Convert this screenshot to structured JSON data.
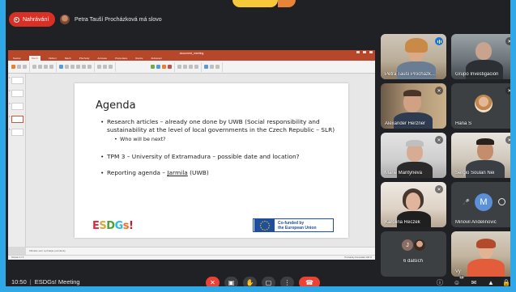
{
  "recording": {
    "label": "Nahrávání"
  },
  "speaking": {
    "text": "Petra Tauší Procházková má slovo"
  },
  "presentation": {
    "window_title": "document_meeting",
    "tabs": [
      "Soubor",
      "Domů",
      "Vložení",
      "Návrh",
      "Přechody",
      "Animace",
      "Prezentace",
      "Revize",
      "Zobrazení"
    ],
    "notes_placeholder": "Klikněte sem a přidejte poznámky",
    "status_left": "Snímek 4 z 5",
    "status_right": "Poznámky  Komentáře   100 %",
    "slide": {
      "title": "Agenda",
      "items": [
        "Research articles – already one done by UWB (Social responsibility and sustainability at the level of local governments in the Czech Republic – SLR)",
        "TPM 3 – University of Extramadura – possible date and location?",
        "Reporting agenda – "
      ],
      "sub_item": "Who will be next? ",
      "reporting_name": "Jarmila",
      "reporting_tail": " (UWB)",
      "logo_text": [
        "E",
        "S",
        "D",
        "G",
        "s",
        "!"
      ],
      "eu_text_line1": "Co-funded by",
      "eu_text_line2": "the European Union"
    }
  },
  "participants": [
    {
      "name": "Petra Tauší Procházk...",
      "state": "speaking"
    },
    {
      "name": "Grupo Investigación",
      "state": "muted"
    },
    {
      "name": "Alexander Herzner",
      "state": "muted"
    },
    {
      "name": "Hana Š",
      "state": "muted"
    },
    {
      "name": "Marie Mantyneva",
      "state": "muted"
    },
    {
      "name": "Sergio Soulan Nei",
      "state": "muted"
    },
    {
      "name": "Karolina Reczek",
      "state": "muted"
    },
    {
      "name": "Minovil Andelinović",
      "state": "muted",
      "initial": "M"
    },
    {
      "name": "6 dalších",
      "state": "group",
      "initials": [
        "J",
        ""
      ]
    },
    {
      "name": "Vy",
      "state": "self"
    }
  ],
  "bottom": {
    "time": "10:50",
    "separator": "|",
    "meeting_name": "ESDGs! Meeting",
    "people_count": "16"
  },
  "colors": {
    "frame": "#2ea8e6",
    "recording": "#d93025",
    "hangup": "#ea4335",
    "ppt_accent": "#b7472a",
    "eu_blue": "#1f4e9c",
    "avatar_blue": "#5b8fd6"
  }
}
